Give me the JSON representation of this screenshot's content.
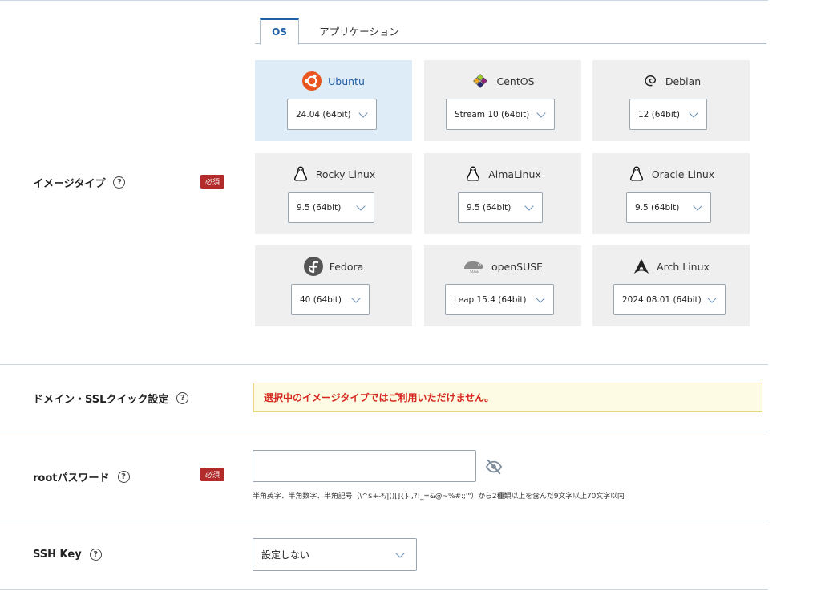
{
  "tabs": [
    {
      "label": "OS",
      "active": true
    },
    {
      "label": "アプリケーション",
      "active": false
    }
  ],
  "image_type": {
    "label": "イメージタイプ",
    "required_badge": "必須",
    "help_icon": "question-circle-icon",
    "selected": "Ubuntu",
    "os_options": [
      {
        "name": "Ubuntu",
        "version": "24.04 (64bit)",
        "icon": "ubuntu-logo-icon"
      },
      {
        "name": "CentOS",
        "version": "Stream 10 (64bit)",
        "icon": "centos-logo-icon"
      },
      {
        "name": "Debian",
        "version": "12 (64bit)",
        "icon": "debian-logo-icon"
      },
      {
        "name": "Rocky Linux",
        "version": "9.5 (64bit)",
        "icon": "linux-penguin-icon"
      },
      {
        "name": "AlmaLinux",
        "version": "9.5 (64bit)",
        "icon": "linux-penguin-icon"
      },
      {
        "name": "Oracle Linux",
        "version": "9.5 (64bit)",
        "icon": "linux-penguin-icon"
      },
      {
        "name": "Fedora",
        "version": "40 (64bit)",
        "icon": "fedora-logo-icon"
      },
      {
        "name": "openSUSE",
        "version": "Leap 15.4 (64bit)",
        "icon": "opensuse-logo-icon"
      },
      {
        "name": "Arch Linux",
        "version": "2024.08.01 (64bit)",
        "icon": "arch-logo-icon"
      }
    ]
  },
  "domain_ssl": {
    "label": "ドメイン・SSLクイック設定",
    "notice": "選択中のイメージタイプではご利用いただけません。"
  },
  "root_password": {
    "label": "rootパスワード",
    "required_badge": "必須",
    "value": "",
    "hint": "半角英字、半角数字、半角記号（\\^$+-*/|()[]{}.,?!_=&@~%#:;'\"）から2種類以上を含んだ9文字以上70文字以内"
  },
  "ssh_key": {
    "label": "SSH Key",
    "value": "設定しない"
  },
  "colors": {
    "accent": "#1f5fa8",
    "required": "#b32a2a",
    "selected_card": "#deecf7",
    "card": "#efefef",
    "notice_text": "#d6281f",
    "notice_bg": "#fdfbe3"
  }
}
